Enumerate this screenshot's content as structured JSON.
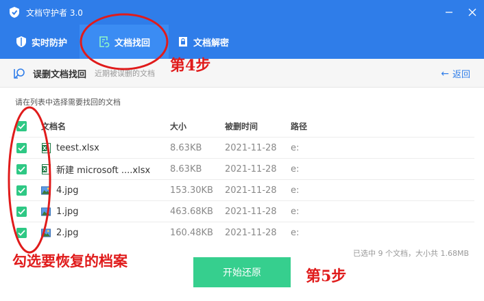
{
  "app": {
    "title": "文档守护者 3.0"
  },
  "tabs": [
    {
      "label": "实时防护",
      "icon": "shield-icon"
    },
    {
      "label": "文档找回",
      "icon": "document-restore-icon",
      "active": true
    },
    {
      "label": "文档解密",
      "icon": "document-lock-icon"
    }
  ],
  "subheader": {
    "title": "误删文档找回",
    "description": "近期被误删的文档",
    "back": "返回"
  },
  "instruction": "请在列表中选择需要找回的文档",
  "table": {
    "headers": {
      "name": "文档名",
      "size": "大小",
      "time": "被删时间",
      "path": "路径"
    },
    "rows": [
      {
        "name": "teest.xlsx",
        "size": "8.63KB",
        "time": "2021-11-28",
        "path": "e:",
        "type": "excel-file-icon"
      },
      {
        "name": "新建 microsoft ....xlsx",
        "size": "8.63KB",
        "time": "2021-11-28",
        "path": "e:",
        "type": "excel-file-icon"
      },
      {
        "name": "4.jpg",
        "size": "153.30KB",
        "time": "2021-11-28",
        "path": "e:",
        "type": "image-file-icon"
      },
      {
        "name": "1.jpg",
        "size": "463.68KB",
        "time": "2021-11-28",
        "path": "e:",
        "type": "image-file-icon"
      },
      {
        "name": "2.jpg",
        "size": "160.48KB",
        "time": "2021-11-28",
        "path": "e:",
        "type": "image-file-icon"
      }
    ]
  },
  "summary": "已选中 9 个文档，大小共 1.68MB",
  "start_button": "开始还原",
  "annotations": {
    "step4": "第4步",
    "step5": "第5步",
    "check_hint": "勾选要恢复的档案"
  },
  "colors": {
    "primary": "#2f7de9",
    "accent": "#36cf8e",
    "annotation": "#e01b1b"
  }
}
